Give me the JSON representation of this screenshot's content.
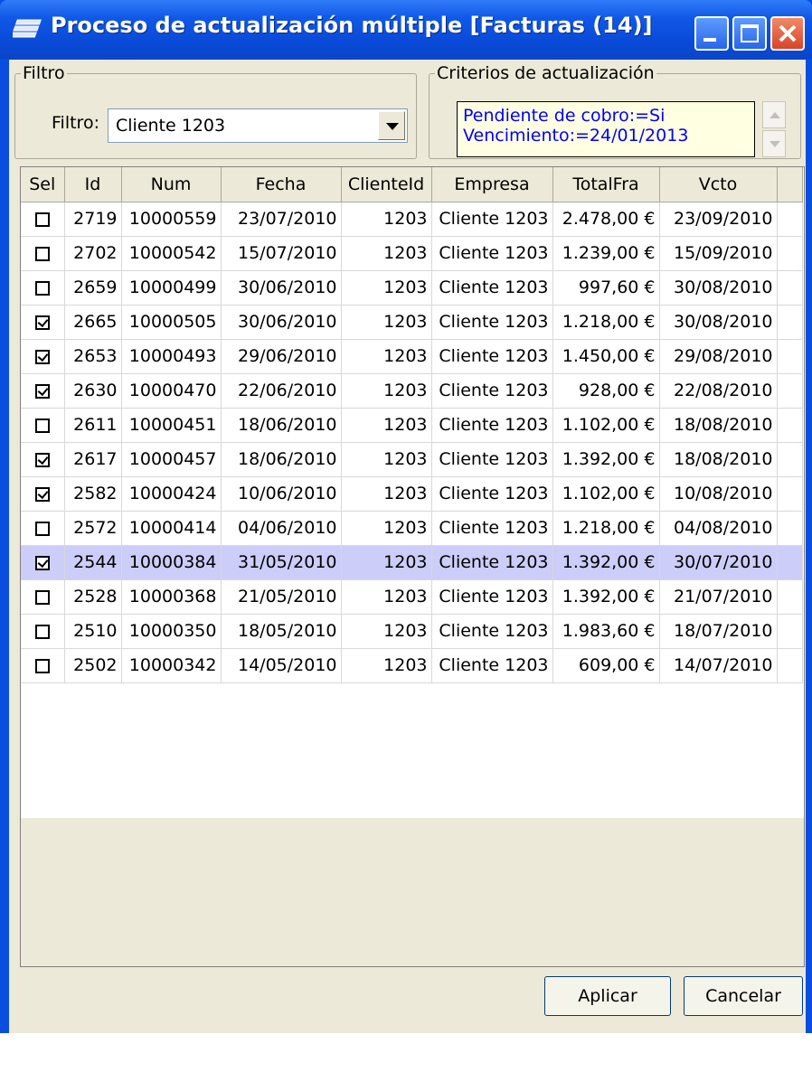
{
  "window": {
    "title": "Proceso de actualización múltiple [Facturas (14)]"
  },
  "filter_group": {
    "legend": "Filtro",
    "label": "Filtro:",
    "selected": "Cliente 1203"
  },
  "criteria_group": {
    "legend": "Criterios de actualización",
    "lines": [
      "Pendiente de cobro:=Si",
      "Vencimiento:=24/01/2013"
    ]
  },
  "grid": {
    "columns": [
      "Sel",
      "Id",
      "Num",
      "Fecha",
      "ClienteId",
      "Empresa",
      "TotalFra",
      "Vcto"
    ],
    "rows": [
      {
        "sel": false,
        "id": "2719",
        "num": "10000559",
        "fecha": "23/07/2010",
        "cliente": "1203",
        "empresa": "Cliente 1203",
        "total": "2.478,00 €",
        "vcto": "23/09/2010"
      },
      {
        "sel": false,
        "id": "2702",
        "num": "10000542",
        "fecha": "15/07/2010",
        "cliente": "1203",
        "empresa": "Cliente 1203",
        "total": "1.239,00 €",
        "vcto": "15/09/2010"
      },
      {
        "sel": false,
        "id": "2659",
        "num": "10000499",
        "fecha": "30/06/2010",
        "cliente": "1203",
        "empresa": "Cliente 1203",
        "total": "997,60 €",
        "vcto": "30/08/2010"
      },
      {
        "sel": true,
        "id": "2665",
        "num": "10000505",
        "fecha": "30/06/2010",
        "cliente": "1203",
        "empresa": "Cliente 1203",
        "total": "1.218,00 €",
        "vcto": "30/08/2010"
      },
      {
        "sel": true,
        "id": "2653",
        "num": "10000493",
        "fecha": "29/06/2010",
        "cliente": "1203",
        "empresa": "Cliente 1203",
        "total": "1.450,00 €",
        "vcto": "29/08/2010"
      },
      {
        "sel": true,
        "id": "2630",
        "num": "10000470",
        "fecha": "22/06/2010",
        "cliente": "1203",
        "empresa": "Cliente 1203",
        "total": "928,00 €",
        "vcto": "22/08/2010"
      },
      {
        "sel": false,
        "id": "2611",
        "num": "10000451",
        "fecha": "18/06/2010",
        "cliente": "1203",
        "empresa": "Cliente 1203",
        "total": "1.102,00 €",
        "vcto": "18/08/2010"
      },
      {
        "sel": true,
        "id": "2617",
        "num": "10000457",
        "fecha": "18/06/2010",
        "cliente": "1203",
        "empresa": "Cliente 1203",
        "total": "1.392,00 €",
        "vcto": "18/08/2010"
      },
      {
        "sel": true,
        "id": "2582",
        "num": "10000424",
        "fecha": "10/06/2010",
        "cliente": "1203",
        "empresa": "Cliente 1203",
        "total": "1.102,00 €",
        "vcto": "10/08/2010"
      },
      {
        "sel": false,
        "id": "2572",
        "num": "10000414",
        "fecha": "04/06/2010",
        "cliente": "1203",
        "empresa": "Cliente 1203",
        "total": "1.218,00 €",
        "vcto": "04/08/2010"
      },
      {
        "sel": true,
        "id": "2544",
        "num": "10000384",
        "fecha": "31/05/2010",
        "cliente": "1203",
        "empresa": "Cliente 1203",
        "total": "1.392,00 €",
        "vcto": "30/07/2010",
        "highlighted": true
      },
      {
        "sel": false,
        "id": "2528",
        "num": "10000368",
        "fecha": "21/05/2010",
        "cliente": "1203",
        "empresa": "Cliente 1203",
        "total": "1.392,00 €",
        "vcto": "21/07/2010"
      },
      {
        "sel": false,
        "id": "2510",
        "num": "10000350",
        "fecha": "18/05/2010",
        "cliente": "1203",
        "empresa": "Cliente 1203",
        "total": "1.983,60 €",
        "vcto": "18/07/2010"
      },
      {
        "sel": false,
        "id": "2502",
        "num": "10000342",
        "fecha": "14/05/2010",
        "cliente": "1203",
        "empresa": "Cliente 1203",
        "total": "609,00 €",
        "vcto": "14/07/2010"
      }
    ]
  },
  "buttons": {
    "apply": "Aplicar",
    "cancel": "Cancelar"
  },
  "colors": {
    "title_bar": "#0a4ee0",
    "highlight_row": "#cccdf8",
    "memo_background": "#ffffe1",
    "memo_text": "#0000ff"
  }
}
